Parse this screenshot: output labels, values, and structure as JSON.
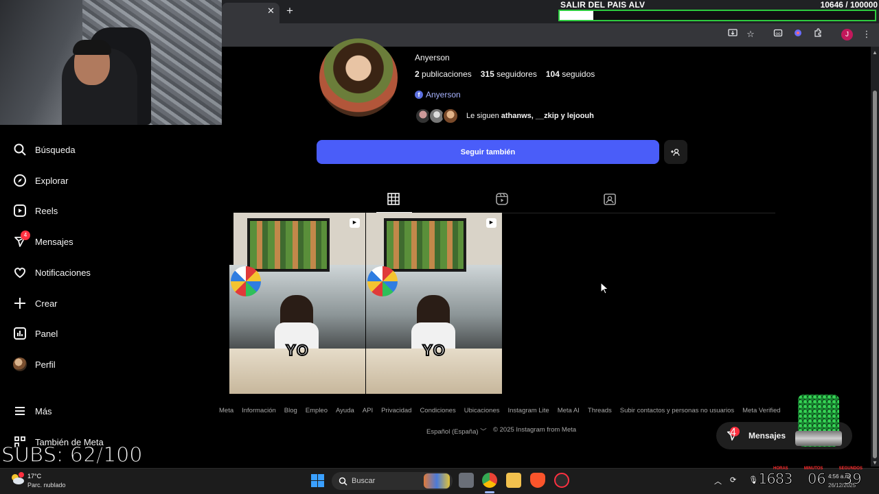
{
  "overlay": {
    "goal_title": "SALIR DEL PAIS ALV",
    "goal_count": "10646  / 100000",
    "goal_progress": 0.106,
    "subs_text": "SUBS: 62/100",
    "timer_hours": "16",
    "timer_minutes": "06",
    "timer_seconds": "39",
    "timer_minutes_prefix": "83",
    "timer_labels": [
      "HORAS",
      "MINUTOS",
      "SEGUNDOS"
    ]
  },
  "browser": {
    "tab_close": "✕",
    "new_tab": "+",
    "avatar_letter": "J"
  },
  "nav": {
    "items": [
      {
        "label": "Búsqueda",
        "icon": "search-icon"
      },
      {
        "label": "Explorar",
        "icon": "compass-icon"
      },
      {
        "label": "Reels",
        "icon": "reels-icon"
      },
      {
        "label": "Mensajes",
        "icon": "messenger-icon",
        "badge": "4"
      },
      {
        "label": "Notificaciones",
        "icon": "heart-icon"
      },
      {
        "label": "Crear",
        "icon": "plus-icon"
      },
      {
        "label": "Panel",
        "icon": "dashboard-icon"
      },
      {
        "label": "Perfil",
        "icon": "avatar"
      }
    ],
    "more": "Más",
    "meta": "También de Meta"
  },
  "profile": {
    "display_name": "Anyerson",
    "posts_count": "2",
    "posts_label": "publicaciones",
    "followers_count": "315",
    "followers_label": "seguidores",
    "following_count": "104",
    "following_label": "seguidos",
    "facebook_link": "Anyerson",
    "followed_by_prefix": "Le siguen",
    "followed_by_names": "athanws, __zkip y lejoouh",
    "follow_button": "Seguir también",
    "suggest_button": "+ᴬ"
  },
  "posts": [
    {
      "caption": "YO"
    },
    {
      "caption": "YO"
    }
  ],
  "footer": {
    "links": [
      "Meta",
      "Información",
      "Blog",
      "Empleo",
      "Ayuda",
      "API",
      "Privacidad",
      "Condiciones",
      "Ubicaciones",
      "Instagram Lite",
      "Meta AI",
      "Threads",
      "Subir contactos y personas no usuarios",
      "Meta Verified"
    ],
    "language": "Español (España)",
    "copyright": "© 2025 Instagram from Meta"
  },
  "messages_pill": {
    "label": "Mensajes",
    "badge": "4"
  },
  "taskbar": {
    "temperature": "17°C",
    "weather": "Parc. nublado",
    "weather_badge": "2",
    "search_label": "Buscar",
    "time": "4:56 a.m.",
    "date": "26/12/2025",
    "lang": "LAA"
  },
  "colors": {
    "follow_button": "#4a5df9",
    "badge": "#ff3040",
    "goal_border": "#2ecc40"
  }
}
